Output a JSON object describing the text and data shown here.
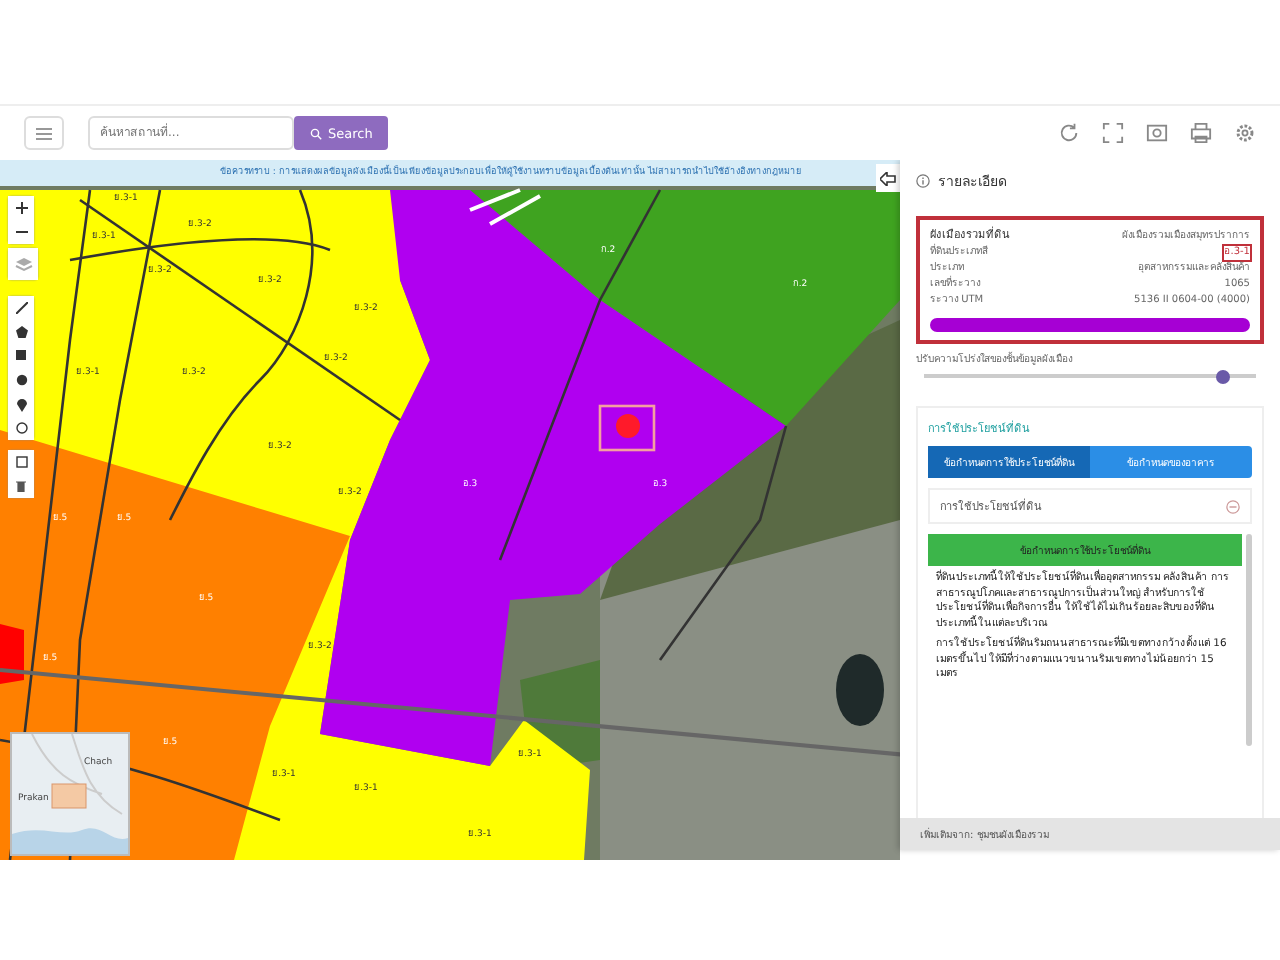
{
  "toolbar": {
    "search": {
      "placeholder": "ค้นหาสถานที่..."
    },
    "search_button": "Search"
  },
  "notice": "ข้อควรทราบ : การแสดงผลข้อมูลผังเมืองนี้เป็นเพียงข้อมูลประกอบเพื่อให้ผู้ใช้งานทราบข้อมูลเบื้องต้นเท่านั้น ไม่สามารถนำไปใช้อ้างอิงทางกฎหมาย",
  "map": {
    "labels": [
      "ย.3-1",
      "ย.3-2",
      "ย.3-1",
      "ก.2",
      "ย.3-2",
      "ย.3-2",
      "ก.2",
      "ย.3-2",
      "ย.3-2",
      "ย.3-1",
      "ย.3-2",
      "ย.3-2",
      "อ.3",
      "อ.3",
      "ย.3-2",
      "ย.5",
      "ย.5",
      "ย.5",
      "ย.3-2",
      "ย.5",
      "ย.5",
      "ย.3-1",
      "ย.3-1",
      "ย.3-1",
      "ย.3-1"
    ],
    "minimap": {
      "labels": [
        "Chach",
        "Prakan"
      ]
    }
  },
  "panel": {
    "title": "รายละเอียด",
    "card": {
      "title": "ผังเมืองรวมที่ดิน",
      "source": "ผังเมืองรวมเมืองสมุทรปราการ",
      "rows": [
        {
          "label": "ที่ดินประเภทสี",
          "value": "อ.3-1",
          "highlighted": true
        },
        {
          "label": "ประเภท",
          "value": "อุตสาหกรรมและคลังสินค้า",
          "highlighted": false
        },
        {
          "label": "เลขที่ระวาง",
          "value": "1065",
          "highlighted": false
        },
        {
          "label": "ระวาง UTM",
          "value": "5136 II 0604-00 (4000)",
          "highlighted": false
        }
      ]
    },
    "opacity": {
      "label": "ปรับความโปร่งใสของชั้นข้อมูลผังเมือง",
      "level": 0.9
    },
    "section": {
      "title": "การใช้ประโยชน์ที่ดิน",
      "tabs": [
        {
          "label": "ข้อกำหนดการใช้ประโยชน์ที่ดิน",
          "selected": true
        },
        {
          "label": "ข้อกำหนดของอาคาร",
          "selected": false
        }
      ],
      "accordion": {
        "title": "การใช้ประโยชน์ที่ดิน",
        "expanded": true,
        "header": "ข้อกำหนดการใช้ประโยชน์ที่ดิน",
        "paragraphs": [
          "ที่ดินประเภทนี้ให้ใช้ประโยชน์ที่ดินเพื่ออุตสาหกรรม คลังสินค้า การสาธารณูปโภคและสาธารณูปการเป็นส่วนใหญ่ สำหรับการใช้ประโยชน์ที่ดินเพื่อกิจการอื่น ให้ใช้ได้ไม่เกินร้อยละสิบของที่ดินประเภทนี้ในแต่ละบริเวณ",
          "การใช้ประโยชน์ที่ดินริมถนนสาธารณะที่มีเขตทางกว้างตั้งแต่ 16 เมตรขึ้นไป ให้มีที่ว่างตามแนวขนานริมเขตทางไม่น้อยกว่า 15 เมตร"
        ]
      }
    },
    "footer": "เพิ่มเติมจาก: ชุมชนผังเมืองรวม"
  }
}
